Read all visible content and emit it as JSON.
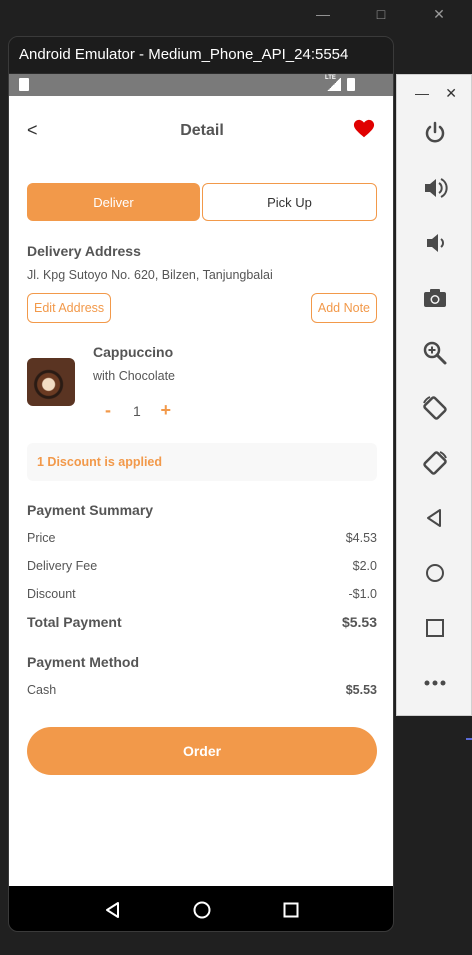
{
  "window": {
    "title": "Android Emulator - Medium_Phone_API_24:5554",
    "side_controls": [
      "minimize",
      "close"
    ],
    "bg_controls": [
      "minimize",
      "maximize",
      "close"
    ]
  },
  "app": {
    "header": {
      "back_label": "<",
      "title": "Detail",
      "favorite_icon": "heart-icon"
    },
    "toggle": {
      "deliver_label": "Deliver",
      "pickup_label": "Pick Up",
      "active": "Deliver"
    },
    "address": {
      "title": "Delivery Address",
      "text": "Jl. Kpg Sutoyo No. 620, Bilzen, Tanjungbalai",
      "edit_label": "Edit Address",
      "note_label": "Add Note"
    },
    "product": {
      "name": "Cappuccino",
      "description": "with Chocolate",
      "minus_label": "-",
      "quantity": "1",
      "plus_label": "+"
    },
    "discount_text": "1 Discount is applied",
    "payment_summary": {
      "title": "Payment Summary",
      "rows": [
        {
          "label": "Price",
          "value": "$4.53"
        },
        {
          "label": "Delivery Fee",
          "value": "$2.0"
        },
        {
          "label": "Discount",
          "value": "-$1.0"
        }
      ],
      "total_label": "Total Payment",
      "total_value": "$5.53"
    },
    "payment_method": {
      "title": "Payment Method",
      "label": "Cash",
      "value": "$5.53"
    },
    "order_label": "Order"
  },
  "colors": {
    "accent": "#f2994a",
    "heart": "#e00000"
  }
}
